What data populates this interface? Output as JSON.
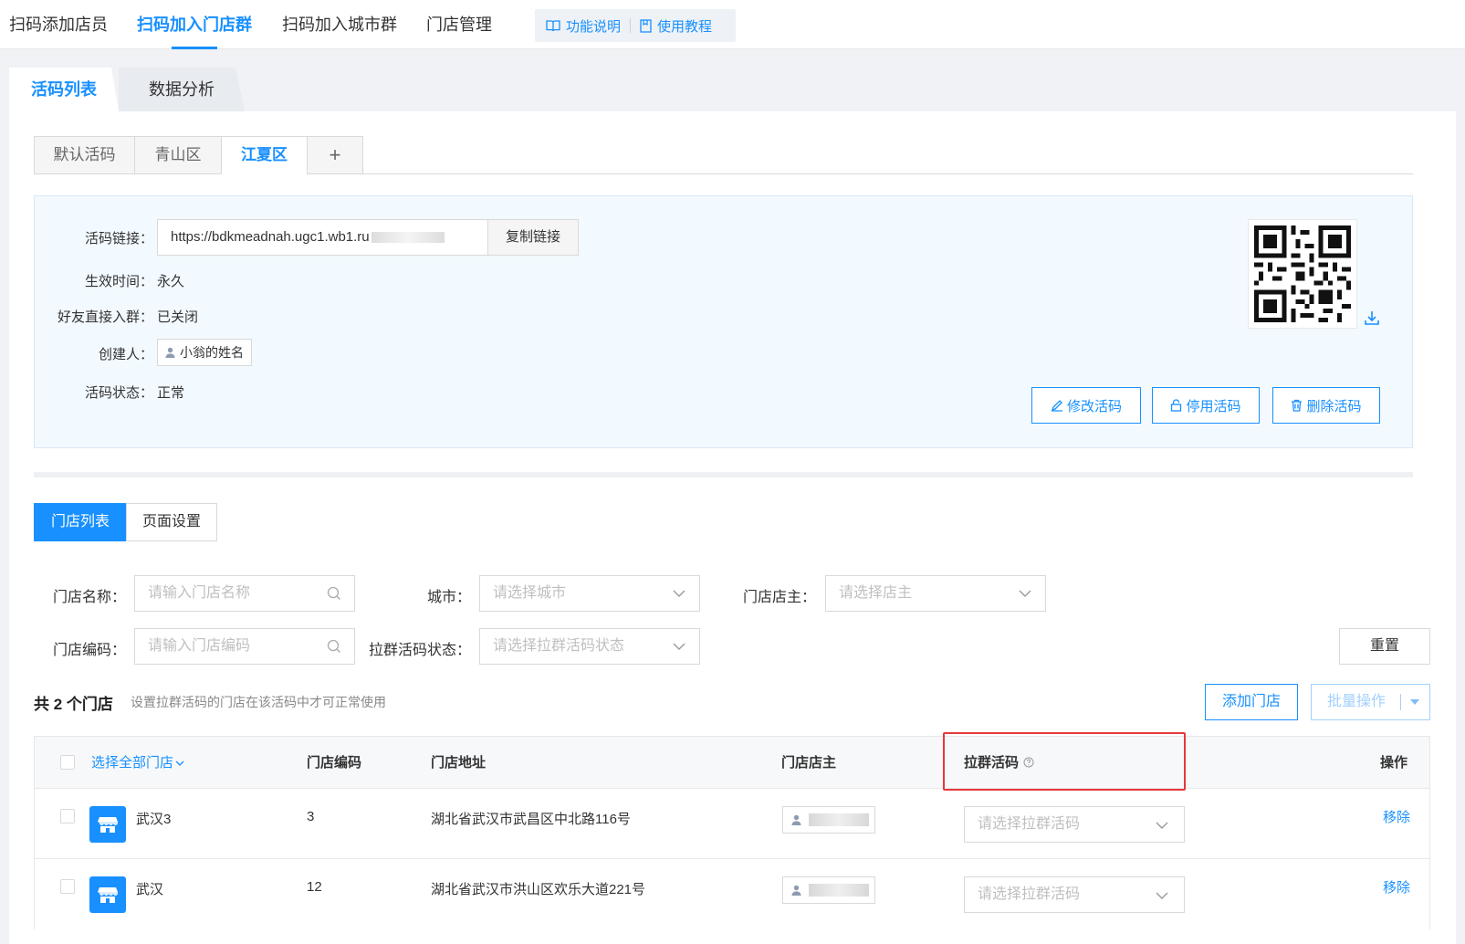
{
  "topnav": {
    "items": [
      "扫码添加店员",
      "扫码加入门店群",
      "扫码加入城市群",
      "门店管理"
    ],
    "active_index": 1,
    "help": {
      "func_desc": "功能说明",
      "tutorial": "使用教程"
    }
  },
  "page_tabs": {
    "list": "活码列表",
    "analysis": "数据分析"
  },
  "code_tabs": [
    "默认活码",
    "青山区",
    "江夏区",
    "+"
  ],
  "code_tabs_active_index": 2,
  "info": {
    "link_label": "活码链接：",
    "link_value": "https://bdkmeadnah.ugc1.wb1.ru",
    "copy_button": "复制链接",
    "effective_label": "生效时间：",
    "effective_value": "永久",
    "friend_label": "好友直接入群：",
    "friend_value": "已关闭",
    "creator_label": "创建人：",
    "creator_value": "小翁的姓名",
    "status_label": "活码状态：",
    "status_value": "正常",
    "actions": {
      "edit": "修改活码",
      "disable": "停用活码",
      "delete": "删除活码"
    }
  },
  "sub_tabs": {
    "store_list": "门店列表",
    "page_settings": "页面设置"
  },
  "filters": {
    "store_name_label": "门店名称：",
    "store_name_placeholder": "请输入门店名称",
    "city_label": "城市：",
    "city_placeholder": "请选择城市",
    "owner_label": "门店店主：",
    "owner_placeholder": "请选择店主",
    "store_code_label": "门店编码：",
    "store_code_placeholder": "请输入门店编码",
    "group_status_label": "拉群活码状态：",
    "group_status_placeholder": "请选择拉群活码状态",
    "reset": "重置"
  },
  "summary": {
    "count_text": "共 2 个门店",
    "hint": "设置拉群活码的门店在该活码中才可正常使用",
    "add_store": "添加门店",
    "batch": "批量操作"
  },
  "table": {
    "headers": {
      "select_all": "选择全部门店",
      "code": "门店编码",
      "address": "门店地址",
      "owner": "门店店主",
      "group_code": "拉群活码",
      "actions": "操作"
    },
    "rows": [
      {
        "name": "武汉3",
        "code": "3",
        "address": "湖北省武汉市武昌区中北路116号",
        "select_placeholder": "请选择拉群活码",
        "action": "移除"
      },
      {
        "name": "武汉",
        "code": "12",
        "address": "湖北省武汉市洪山区欢乐大道221号",
        "select_placeholder": "请选择拉群活码",
        "action": "移除"
      }
    ]
  },
  "colors": {
    "primary": "#1890ff",
    "highlight": "#e5383b"
  }
}
